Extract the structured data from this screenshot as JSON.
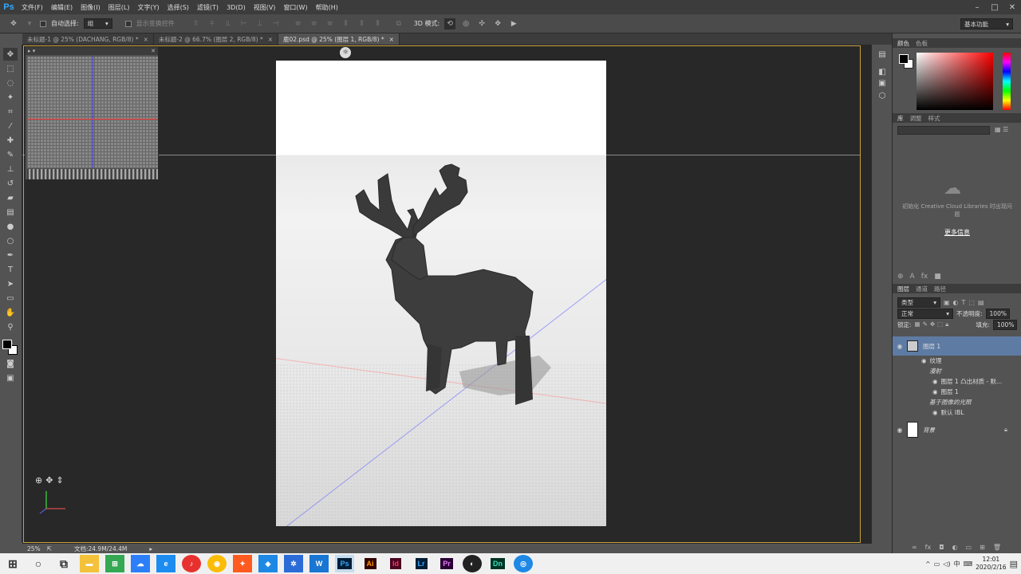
{
  "app": {
    "logo": "Ps"
  },
  "menu": [
    "文件(F)",
    "编辑(E)",
    "图像(I)",
    "图层(L)",
    "文字(Y)",
    "选择(S)",
    "滤镜(T)",
    "3D(D)",
    "视图(V)",
    "窗口(W)",
    "帮助(H)"
  ],
  "options": {
    "auto_select_label": "自动选择:",
    "auto_select_value": "组",
    "show_transform_label": "显示变换控件",
    "mode_3d_label": "3D 模式:",
    "workspace": "基本功能"
  },
  "tabs": [
    {
      "label": "未标题-1 @ 25% (DACHANG, RGB/8) *",
      "close": "×"
    },
    {
      "label": "未标题-2 @ 66.7% (图层 2, RGB/8) *",
      "close": "×"
    },
    {
      "label": "鹿02.psd @ 25% (图层 1, RGB/8) *",
      "close": "×"
    }
  ],
  "status": {
    "zoom": "25%",
    "doc": "文档:24.9M/24.4M"
  },
  "color_panel": {
    "tabs": [
      "颜色",
      "色板"
    ]
  },
  "library_panel": {
    "tabs": [
      "库",
      "调整",
      "样式"
    ],
    "message": "初始化 Creative Cloud Libraries 时出现问题",
    "more_info": "更多信息"
  },
  "layers_panel": {
    "tabs": [
      "图层",
      "通道",
      "路径"
    ],
    "filter": "类型",
    "blend_mode": "正常",
    "opacity_label": "不透明度:",
    "opacity_value": "100%",
    "lock_label": "锁定:",
    "fill_label": "填充:",
    "fill_value": "100%",
    "layers": [
      {
        "name": "图层 1",
        "selected": true
      },
      {
        "name": "纹理"
      },
      {
        "name": "漫射"
      },
      {
        "name": "图层 1 凸出材质 - 默..."
      },
      {
        "name": "图层 1"
      },
      {
        "name": "基于图像的光照"
      },
      {
        "name": "默认 IBL"
      },
      {
        "name": "背景"
      }
    ]
  },
  "taskbar": {
    "apps": [
      "Ps",
      "Ai",
      "Id",
      "Lr",
      "Pr",
      "Dn"
    ],
    "time": "12:01",
    "date": "2020/2/16"
  },
  "colors": {
    "accent": "#31a8ff",
    "selection_frame": "#c8a23a",
    "deer": "#3a3a3a"
  }
}
